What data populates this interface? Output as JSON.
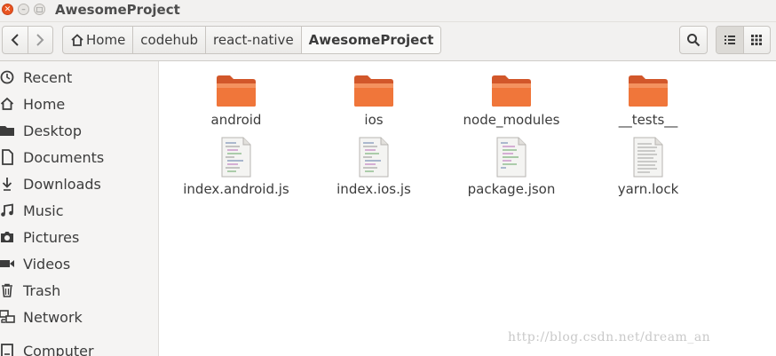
{
  "window": {
    "title": "AwesomeProject"
  },
  "toolbar": {
    "breadcrumbs": [
      "Home",
      "codehub",
      "react-native",
      "AwesomeProject"
    ]
  },
  "sidebar": {
    "items": [
      {
        "label": "Recent",
        "icon": "clock-icon"
      },
      {
        "label": "Home",
        "icon": "home-icon"
      },
      {
        "label": "Desktop",
        "icon": "folder-icon"
      },
      {
        "label": "Documents",
        "icon": "document-icon"
      },
      {
        "label": "Downloads",
        "icon": "download-icon"
      },
      {
        "label": "Music",
        "icon": "music-icon"
      },
      {
        "label": "Pictures",
        "icon": "camera-icon"
      },
      {
        "label": "Videos",
        "icon": "video-icon"
      },
      {
        "label": "Trash",
        "icon": "trash-icon"
      },
      {
        "label": "Network",
        "icon": "network-icon"
      },
      {
        "label": "Computer",
        "icon": "computer-icon"
      }
    ]
  },
  "files": [
    {
      "name": "android",
      "type": "folder"
    },
    {
      "name": "ios",
      "type": "folder"
    },
    {
      "name": "node_modules",
      "type": "folder"
    },
    {
      "name": "__tests__",
      "type": "folder"
    },
    {
      "name": "index.android.js",
      "type": "script"
    },
    {
      "name": "index.ios.js",
      "type": "script"
    },
    {
      "name": "package.json",
      "type": "script"
    },
    {
      "name": "yarn.lock",
      "type": "text"
    }
  ],
  "watermark": "http://blog.csdn.net/dream_an",
  "colors": {
    "accent": "#e95420",
    "folder": "#f0763a"
  }
}
